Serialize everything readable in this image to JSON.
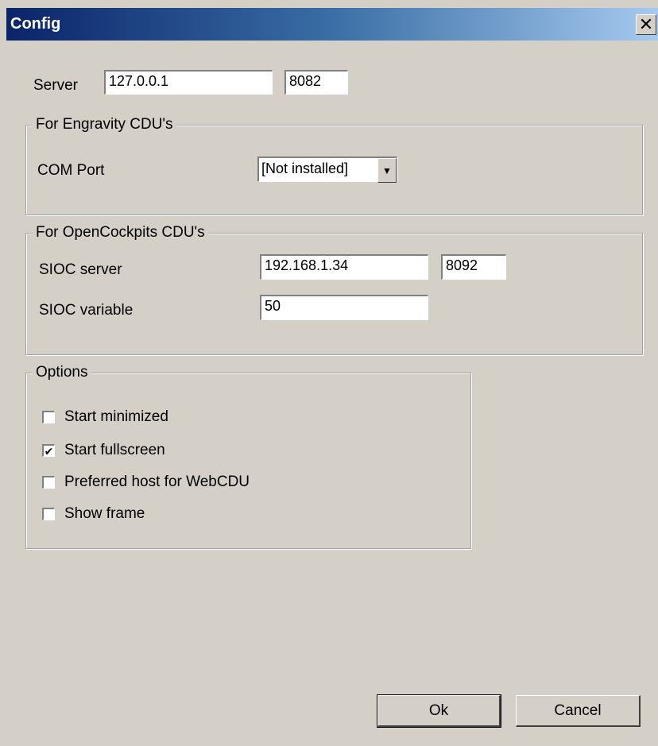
{
  "window": {
    "title": "Config",
    "close_glyph": "✕"
  },
  "server": {
    "label": "Server",
    "host": "127.0.0.1",
    "port": "8082"
  },
  "engravity": {
    "group_title": "For Engravity CDU's",
    "com_port_label": "COM Port",
    "com_port_value": "[Not installed]",
    "arrow_icon": "▼"
  },
  "opencockpits": {
    "group_title": "For OpenCockpits CDU's",
    "sioc_server_label": "SIOC server",
    "sioc_server_host": "192.168.1.34",
    "sioc_server_port": "8092",
    "sioc_variable_label": "SIOC variable",
    "sioc_variable_value": "50"
  },
  "options": {
    "group_title": "Options",
    "items": [
      {
        "label": "Start minimized",
        "checked": false
      },
      {
        "label": "Start fullscreen",
        "checked": true
      },
      {
        "label": "Preferred host for WebCDU",
        "checked": false
      },
      {
        "label": "Show frame",
        "checked": false
      }
    ],
    "check_glyph": "✔"
  },
  "buttons": {
    "ok": "Ok",
    "cancel": "Cancel"
  },
  "colors": {
    "window_bg": "#d4d0c8",
    "title_gradient_start": "#0a246a",
    "title_gradient_end": "#a6caf0"
  }
}
